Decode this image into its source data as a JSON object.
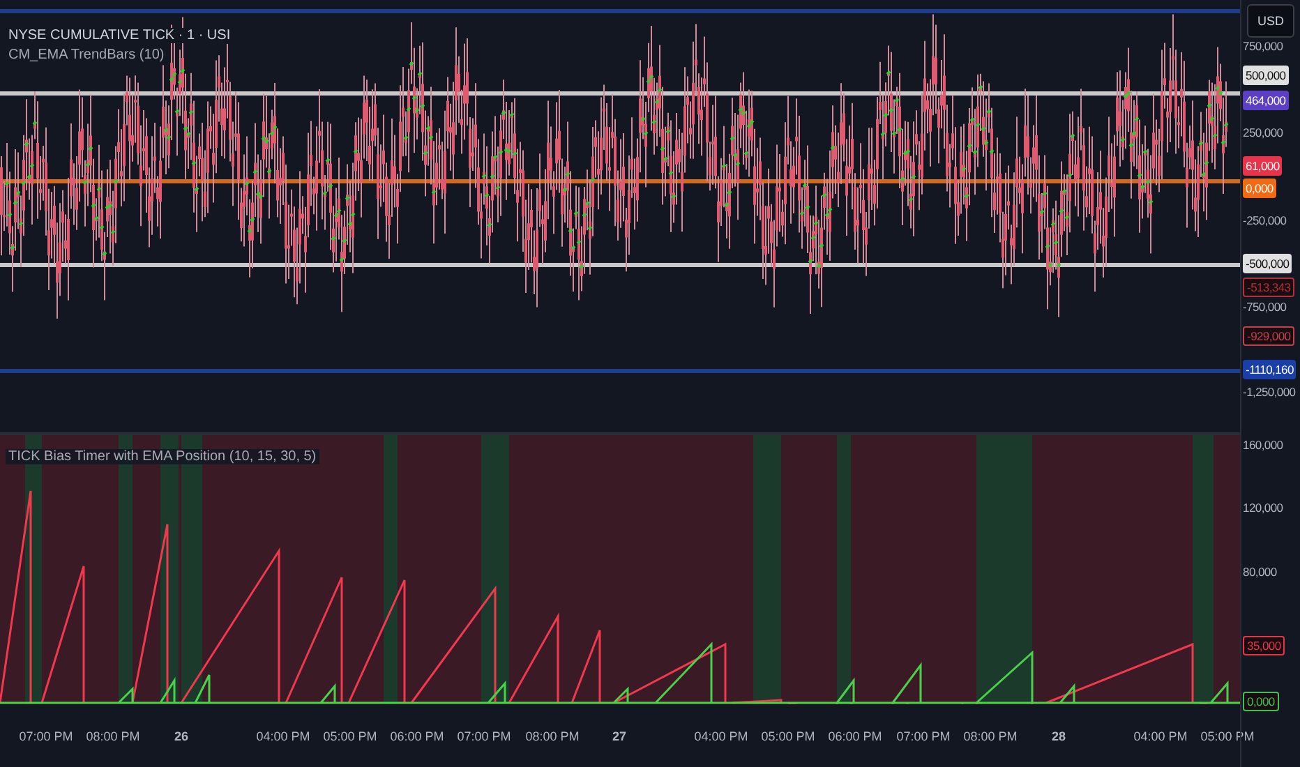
{
  "symbol_title": "NYSE CUMULATIVE TICK · 1 · USI",
  "main_indicator": "CM_EMA TrendBars (10)",
  "currency": "USD",
  "price_axis": [
    {
      "text": "750,000",
      "kind": "tick"
    },
    {
      "text": "500,000",
      "kind": "badge",
      "color": "#e0e0e0"
    },
    {
      "text": "464,000",
      "kind": "badge",
      "color": "#5b3fc4"
    },
    {
      "text": "250,000",
      "kind": "tick"
    },
    {
      "text": "61,000",
      "kind": "badge",
      "color": "#e8334a"
    },
    {
      "text": "0,000",
      "kind": "badge",
      "color": "#f26b12"
    },
    {
      "text": "-250,000",
      "kind": "tick"
    },
    {
      "text": "-500,000",
      "kind": "badge",
      "color": "#e0e0e0"
    },
    {
      "text": "-513,343",
      "kind": "outline",
      "color": "#b0303e"
    },
    {
      "text": "-750,000",
      "kind": "tick"
    },
    {
      "text": "-929,000",
      "kind": "outline",
      "color": "#c0404e"
    },
    {
      "text": "-1110,160",
      "kind": "badge",
      "color": "#1a3fa8"
    },
    {
      "text": "-1,250,000",
      "kind": "tick"
    }
  ],
  "lower_indicator": "TICK Bias Timer with EMA Position (10, 15, 30, 5)",
  "lower_axis": [
    {
      "text": "160,000",
      "kind": "tick"
    },
    {
      "text": "120,000",
      "kind": "tick"
    },
    {
      "text": "80,000",
      "kind": "tick"
    },
    {
      "text": "35,000",
      "kind": "outline",
      "color": "#e8334a"
    },
    {
      "text": "0,000",
      "kind": "outline",
      "color": "#3fbf4f"
    }
  ],
  "time_axis": [
    {
      "text": "07:00 PM",
      "kind": "time"
    },
    {
      "text": "08:00 PM",
      "kind": "time"
    },
    {
      "text": "26",
      "kind": "day"
    },
    {
      "text": "04:00 PM",
      "kind": "time"
    },
    {
      "text": "05:00 PM",
      "kind": "time"
    },
    {
      "text": "06:00 PM",
      "kind": "time"
    },
    {
      "text": "07:00 PM",
      "kind": "time"
    },
    {
      "text": "08:00 PM",
      "kind": "time"
    },
    {
      "text": "27",
      "kind": "day"
    },
    {
      "text": "04:00 PM",
      "kind": "time"
    },
    {
      "text": "05:00 PM",
      "kind": "time"
    },
    {
      "text": "06:00 PM",
      "kind": "time"
    },
    {
      "text": "07:00 PM",
      "kind": "time"
    },
    {
      "text": "08:00 PM",
      "kind": "time"
    },
    {
      "text": "28",
      "kind": "day"
    },
    {
      "text": "04:00 PM",
      "kind": "time"
    },
    {
      "text": "05:00 PM",
      "kind": "time"
    }
  ]
}
